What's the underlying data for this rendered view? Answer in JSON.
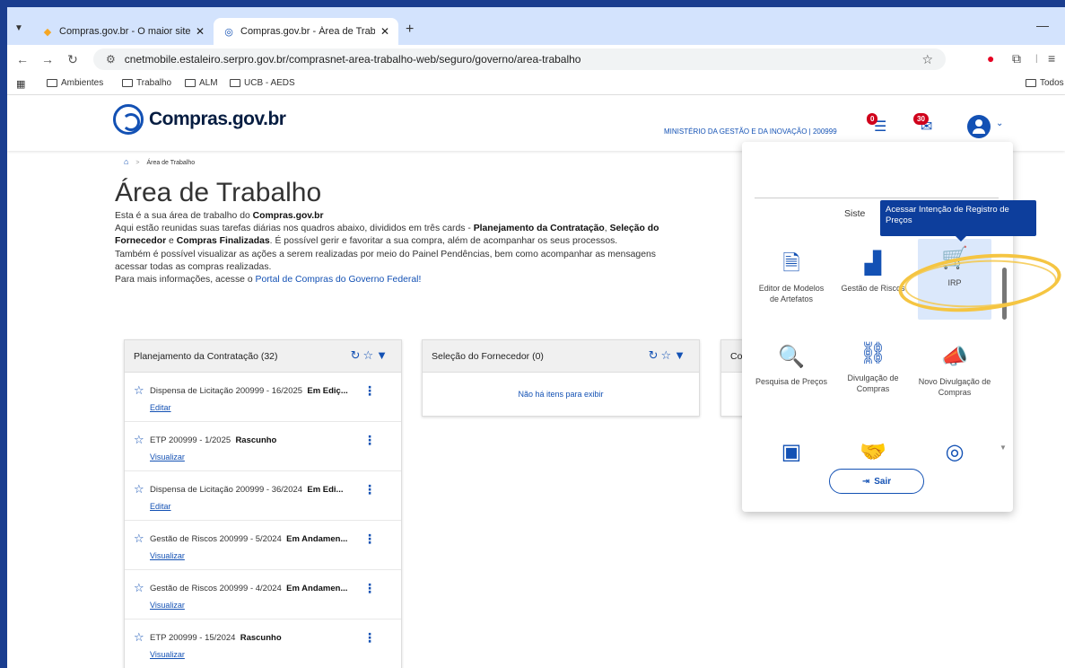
{
  "browser": {
    "tabs": [
      {
        "title": "Compras.gov.br - O maior site d",
        "active": false
      },
      {
        "title": "Compras.gov.br - Área de Traba",
        "active": true
      }
    ],
    "url": "cnetmobile.estaleiro.serpro.gov.br/comprasnet-area-trabalho-web/seguro/governo/area-trabalho",
    "bookmarks": [
      "Ambientes",
      "Trabalho",
      "ALM",
      "UCB - AEDS"
    ],
    "all_bookmarks": "Todos"
  },
  "header": {
    "logo": "Compras.gov.br",
    "org": "MINISTÉRIO DA GESTÃO E DA INOVAÇÃO | 200999",
    "tasks_badge": "0",
    "messages_badge": "30"
  },
  "breadcrumb": {
    "current": "Área de Trabalho"
  },
  "page": {
    "title": "Área de Trabalho",
    "intro_1": "Esta é a sua área de trabalho do ",
    "intro_1_b": "Compras.gov.br",
    "intro_2": "Aqui estão reunidas suas tarefas diárias nos quadros abaixo, divididos em três cards - ",
    "intro_2_b1": "Planejamento da Contratação",
    "intro_2_sep": ", ",
    "intro_2_b2": "Seleção do",
    "intro_3_b1": "Fornecedor",
    "intro_3_e": " e ",
    "intro_3_b2": "Compras Finalizadas",
    "intro_3": ". É possível gerir e favoritar a sua compra, além de acompanhar os seus processos.",
    "intro_4": "Também é possível visualizar as ações a serem realizadas por meio do Painel Pendências, bem como acompanhar as mensagens",
    "intro_5": "acessar todas as compras realizadas.",
    "intro_6": "Para mais informações, acesse o ",
    "intro_6_link": "Portal de Compras do Governo Federal!"
  },
  "cards": {
    "planejamento": {
      "title": "Planejamento da Contratação (32)",
      "items": [
        {
          "name": "Dispensa de Licitação 200999 - 16/2025",
          "status": "Em Ediç...",
          "action": "Editar"
        },
        {
          "name": "ETP 200999 - 1/2025",
          "status": "Rascunho",
          "action": "Visualizar"
        },
        {
          "name": "Dispensa de Licitação 200999 - 36/2024",
          "status": "Em Edi...",
          "action": "Editar"
        },
        {
          "name": "Gestão de Riscos 200999 - 5/2024",
          "status": "Em Andamen...",
          "action": "Visualizar"
        },
        {
          "name": "Gestão de Riscos 200999 - 4/2024",
          "status": "Em Andamen...",
          "action": "Visualizar"
        },
        {
          "name": "ETP 200999 - 15/2024",
          "status": "Rascunho",
          "action": "Visualizar"
        }
      ]
    },
    "selecao": {
      "title": "Seleção do Fornecedor (0)",
      "empty": "Não há itens para exibir"
    },
    "compras": {
      "title": "Co"
    }
  },
  "panel": {
    "sistemas_label": "Siste",
    "tiles": [
      {
        "label": "Editor de Modelos de Artefatos"
      },
      {
        "label": "Gestão de Riscos"
      },
      {
        "label": "IRP"
      },
      {
        "label": "Pesquisa de Preços"
      },
      {
        "label": "Divulgação de Compras"
      },
      {
        "label": "Novo Divulgação de Compras"
      }
    ],
    "logout": "Sair",
    "tooltip": "Acessar Intenção de Registro de Preços"
  },
  "colors": {
    "primary": "#1351b4",
    "highlight": "#f5c542",
    "badge": "#d0021b",
    "tooltip": "#0d3e9c"
  }
}
